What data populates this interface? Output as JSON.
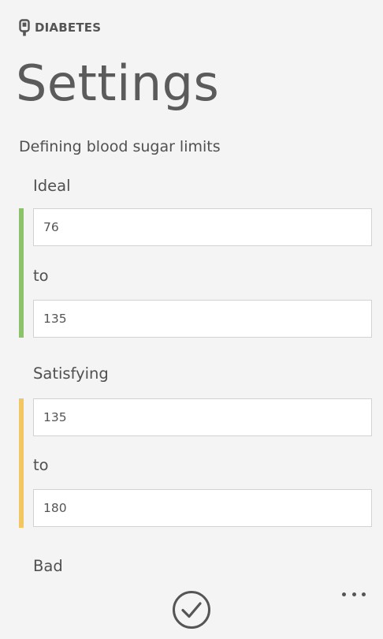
{
  "app": {
    "name": "DIABETES",
    "icon": "glucose-meter-icon"
  },
  "page": {
    "title": "Settings",
    "subtitle": "Defining blood sugar limits"
  },
  "ranges": {
    "ideal": {
      "label": "Ideal",
      "from": "76",
      "to_label": "to",
      "to": "135",
      "color": "#8bc26a"
    },
    "satisfying": {
      "label": "Satisfying",
      "from": "135",
      "to_label": "to",
      "to": "180",
      "color": "#f2c660"
    },
    "bad": {
      "label": "Bad"
    }
  },
  "app_bar": {
    "save_icon": "check-circle-icon",
    "more_icon": "ellipsis-icon"
  }
}
